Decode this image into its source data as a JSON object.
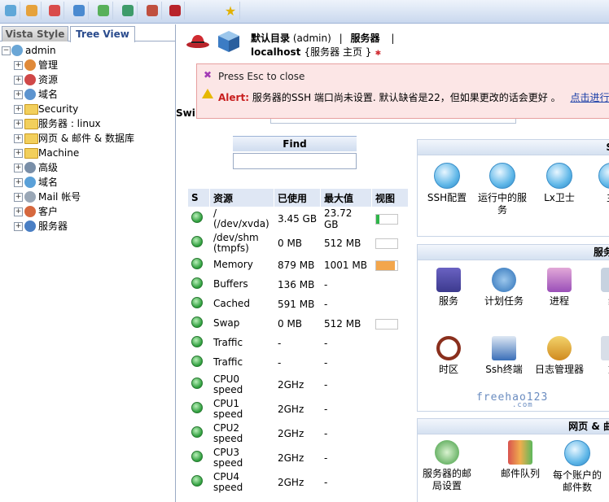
{
  "toolbar": {
    "icons": [
      "home-icon",
      "bag-icon",
      "flag-icon",
      "cube-icon",
      "tools-icon",
      "tree-icon",
      "user-icon",
      "hat-icon",
      "star-icon"
    ]
  },
  "sidebar": {
    "tabs": [
      "Vista Style",
      "Tree View"
    ],
    "root": "admin",
    "items": [
      "管理",
      "资源",
      "域名",
      "Security",
      "服务器 : linux",
      "网页 & 邮件 & 数据库",
      "Machine",
      "高级",
      "域名",
      "Mail 帐号",
      "客户",
      "服务器"
    ]
  },
  "header": {
    "breadcrumb_default": "默认目录",
    "breadcrumb_user": "(admin)",
    "sep": "|",
    "breadcrumb_server": "服务器",
    "title_host": "localhost",
    "title_rest": "{服务器 主页 }"
  },
  "alert": {
    "close_text": "Press Esc to close",
    "label": "Alert:",
    "message": "服务器的SSH 端口尚未设置. 默认缺省是22，但如果更改的话会更好 。",
    "link": "点击进行更改"
  },
  "switch_label": "Swi",
  "find": {
    "title": "Find"
  },
  "resources": {
    "headers": [
      "S",
      "资源",
      "已使用",
      "最大值",
      "视图"
    ],
    "rows": [
      {
        "name": "/ (/dev/xvda)",
        "used": "3.45 GB",
        "max": "23.72 GB",
        "fill": 0.15,
        "color": "#2fb54a"
      },
      {
        "name": "/dev/shm (tmpfs)",
        "used": "0 MB",
        "max": "512 MB",
        "fill": 0,
        "color": "#2fb54a"
      },
      {
        "name": "Memory",
        "used": "879 MB",
        "max": "1001 MB",
        "fill": 0.88,
        "color": "#f3a64c"
      },
      {
        "name": "Buffers",
        "used": "136 MB",
        "max": "-"
      },
      {
        "name": "Cached",
        "used": "591 MB",
        "max": "-"
      },
      {
        "name": "Swap",
        "used": "0 MB",
        "max": "512 MB",
        "fill": 0,
        "color": "#2fb54a"
      },
      {
        "name": "Traffic",
        "used": "-",
        "max": "-"
      },
      {
        "name": "Traffic",
        "used": "-",
        "max": "-"
      },
      {
        "name": "CPU0 speed",
        "used": "2GHz",
        "max": "-"
      },
      {
        "name": "CPU1 speed",
        "used": "2GHz",
        "max": "-"
      },
      {
        "name": "CPU2 speed",
        "used": "2GHz",
        "max": "-"
      },
      {
        "name": "CPU3 speed",
        "used": "2GHz",
        "max": "-"
      },
      {
        "name": "CPU4 speed",
        "used": "2GHz",
        "max": "-"
      }
    ]
  },
  "panels": {
    "p1": {
      "title": "S",
      "items": [
        "SSH配置",
        "运行中的服务",
        "Lx卫士",
        "主"
      ]
    },
    "p2": {
      "title": "服务",
      "items": [
        "服务",
        "计划任务",
        "进程",
        "组",
        "时区",
        "Ssh终端",
        "日志管理器",
        "文"
      ],
      "watermark": "freehao123",
      "watermark_sub": ".com"
    },
    "p3": {
      "title": "网页 & 曲",
      "items": [
        "服务器的邮局设置",
        "邮件队列",
        "每个账户的邮件数"
      ]
    }
  }
}
